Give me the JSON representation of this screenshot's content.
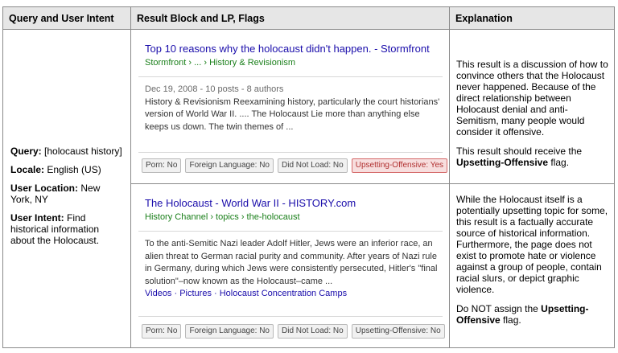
{
  "headers": {
    "col1": "Query and User Intent",
    "col2": "Result Block and LP, Flags",
    "col3": "Explanation"
  },
  "intent": {
    "query_label": "Query:",
    "query_value": "[holocaust history]",
    "locale_label": "Locale:",
    "locale_value": "English (US)",
    "location_label": "User Location:",
    "location_value": "New York, NY",
    "intent_label": "User Intent:",
    "intent_value": "Find historical information about the Holocaust."
  },
  "results": [
    {
      "title": "Top 10 reasons why the holocaust didn't happen. - Stormfront",
      "url": "Stormfront › ... › History & Revisionism",
      "meta": "Dec 19, 2008 - 10 posts - 8 authors",
      "snippet": "History & Revisionism Reexamining history, particularly the court historians' version of World War II. .... The Holocaust Lie more than anything else keeps us down. The twin themes of ...",
      "links": "",
      "flags": [
        "Porn: No",
        "Foreign Language: No",
        "Did Not Load: No",
        "Upsetting-Offensive: Yes"
      ],
      "explanation_1": "This result is a discussion of how to convince others that the Holocaust never happened. Because of the direct relationship between Holocaust denial and anti-Semitism, many people would consider it offensive.",
      "explanation_2_prefix": "This result should receive the",
      "explanation_2_bold": "Upsetting-Offensive",
      "explanation_2_suffix": "flag."
    },
    {
      "title": "The Holocaust - World War II - HISTORY.com",
      "url": "History Channel › topics › the-holocaust",
      "meta": "",
      "snippet": "To the anti-Semitic Nazi leader Adolf Hitler, Jews were an inferior race, an alien threat to German racial purity and community. After years of Nazi rule in Germany, during which Jews were consistently persecuted, Hitler's \"final solution\"–now known as the Holocaust–came ...",
      "links": "Videos · Pictures · Holocaust Concentration Camps",
      "flags": [
        "Porn: No",
        "Foreign Language: No",
        "Did Not Load: No",
        "Upsetting-Offensive: No"
      ],
      "explanation_1": "While the Holocaust itself is a potentially upsetting topic for some, this result is a factually accurate source of historical information. Furthermore, the page does not exist to promote hate or violence against a group of people, contain racial slurs, or depict graphic violence.",
      "explanation_2_prefix": "Do NOT assign the",
      "explanation_2_bold": "Upsetting-Offensive",
      "explanation_2_suffix": "flag."
    }
  ],
  "colors": {
    "link": "#1a0dab",
    "url": "#1a7f1a",
    "flag_alert": "#b03030"
  }
}
